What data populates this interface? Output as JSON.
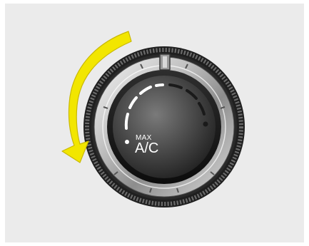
{
  "knob": {
    "label_top": "MAX",
    "label_bottom": "A/C"
  },
  "colors": {
    "background": "#ebebeb",
    "arrow": "#f2e600",
    "arrow_outline": "#c9b800",
    "knob_face": "#4a4a4a",
    "indicator": "#ffffff"
  },
  "icons": {
    "rotation_arrow": "counterclockwise-arrow"
  }
}
